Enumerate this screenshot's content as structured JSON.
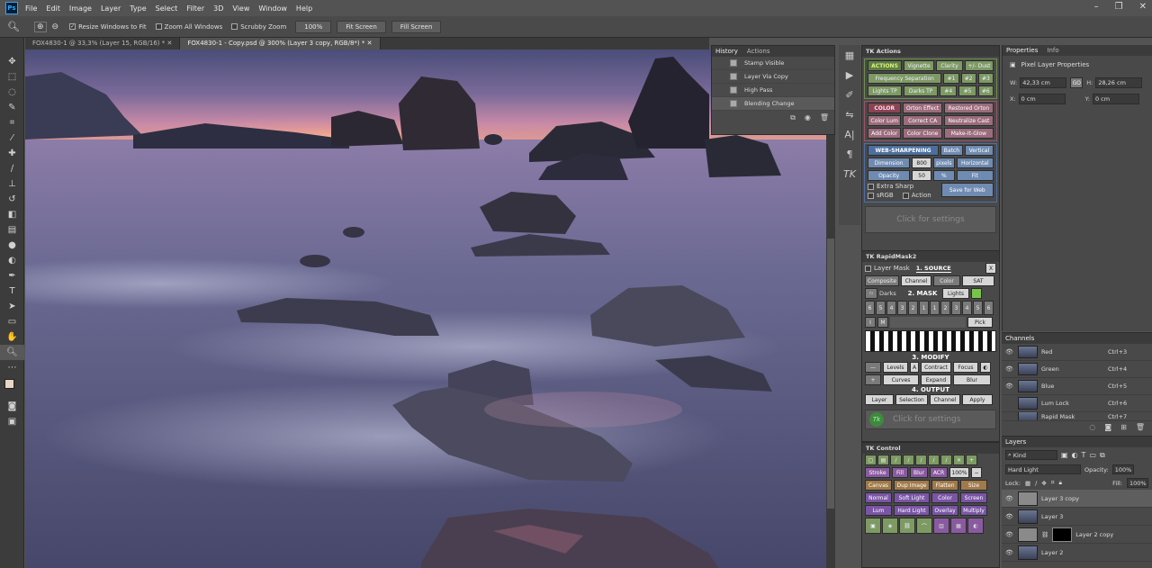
{
  "menubar": {
    "logo": "Ps",
    "items": [
      "File",
      "Edit",
      "Image",
      "Layer",
      "Type",
      "Select",
      "Filter",
      "3D",
      "View",
      "Window",
      "Help"
    ]
  },
  "options": {
    "resize_windows": "Resize Windows to Fit",
    "zoom_all": "Zoom All Windows",
    "scrubby": "Scrubby Zoom",
    "zoom_pct": "100%",
    "fit_screen": "Fit Screen",
    "fill_screen": "Fill Screen"
  },
  "doc_tabs": [
    "FOX4830-1 @ 33,3% (Layer 15, RGB/16) *",
    "FOX4830-1 - Copy.psd @ 300% (Layer 3 copy, RGB/8*) *"
  ],
  "history": {
    "tabs": [
      "History",
      "Actions"
    ],
    "items": [
      "Stamp Visible",
      "Layer Via Copy",
      "High Pass",
      "Blending Change"
    ]
  },
  "tk_actions": {
    "title": "TK Actions",
    "actions_label": "ACTIONS",
    "vignette": "Vignette",
    "clarity": "Clarity",
    "dust": "+/- Dust",
    "freq_sep": "Frequency Separation",
    "n1": "#1",
    "n2": "#2",
    "n3": "#3",
    "lights_tp": "Lights TP",
    "darks_tp": "Darks TP",
    "n4": "#4",
    "n5": "#5",
    "n6": "#6",
    "color_label": "COLOR",
    "orton_effect": "Orton Effect",
    "restored_orton": "Restored Orton",
    "color_lum": "Color Lum",
    "correct_ca": "Correct CA",
    "neutralize_cast": "Neutralize Cast",
    "add_color": "Add Color",
    "color_clone": "Color Clone",
    "make_it_glow": "Make-It-Glow",
    "websharp_label": "WEB-SHARPENING",
    "batch": "Batch",
    "vertical": "Vertical",
    "dimension": "Dimension",
    "dim_val": "800",
    "pixels": "pixels",
    "horizontal": "Horizontal",
    "opacity": "Opacity",
    "op_val": "50",
    "pct": "%",
    "fit": "Fit",
    "extra_sharp": "Extra Sharp",
    "srgb": "sRGB",
    "action": "Action",
    "save_web": "Save for Web",
    "click_settings": "Click for settings"
  },
  "rapidmask": {
    "title": "TK RapidMask2",
    "layer_mask": "Layer Mask",
    "source_label": "1. SOURCE",
    "x": "X",
    "composite": "Composite",
    "channel": "Channel",
    "color": "Color",
    "sat": "SAT",
    "darks": "Darks",
    "mask_label": "2. MASK",
    "lights": "Lights",
    "zone_nums": [
      "6",
      "5",
      "4",
      "3",
      "2",
      "1",
      "1",
      "2",
      "3",
      "4",
      "5",
      "6"
    ],
    "i": "I",
    "m": "M",
    "pick": "Pick",
    "modify_label": "3. MODIFY",
    "minus": "—",
    "levels": "Levels",
    "a": "A",
    "contract": "Contract",
    "focus": "Focus",
    "plus": "+",
    "curves": "Curves",
    "expand": "Expand",
    "blur": "Blur",
    "output_label": "4. OUTPUT",
    "layer": "Layer",
    "selection": "Selection",
    "out_channel": "Channel",
    "apply": "Apply",
    "click_settings": "Click for settings"
  },
  "tkcontrol": {
    "title": "TK Control",
    "stroke": "Stroke",
    "fill": "Fill",
    "blur": "Blur",
    "acr": "ACR",
    "pct": "100%",
    "canvas": "Canvas",
    "dup_image": "Dup Image",
    "flatten": "Flatten",
    "size": "Size",
    "normal": "Normal",
    "soft_light": "Soft Light",
    "color": "Color",
    "screen": "Screen",
    "lum": "Lum",
    "hard_light": "Hard Light",
    "overlay": "Overlay",
    "multiply": "Multiply"
  },
  "properties": {
    "tabs": [
      "Properties",
      "Info"
    ],
    "title": "Pixel Layer Properties",
    "w_label": "W:",
    "w_val": "42,33 cm",
    "go": "GO",
    "h_label": "H:",
    "h_val": "28,26 cm",
    "x_label": "X:",
    "x_val": "0 cm",
    "y_label": "Y:",
    "y_val": "0 cm"
  },
  "channels": {
    "title": "Channels",
    "rows": [
      {
        "name": "Red",
        "key": "Ctrl+3"
      },
      {
        "name": "Green",
        "key": "Ctrl+4"
      },
      {
        "name": "Blue",
        "key": "Ctrl+5"
      },
      {
        "name": "Lum Lock",
        "key": "Ctrl+6"
      },
      {
        "name": "Rapid Mask",
        "key": "Ctrl+7"
      }
    ]
  },
  "layers": {
    "title": "Layers",
    "kind": "Kind",
    "blend": "Hard Light",
    "opacity_label": "Opacity:",
    "opacity_val": "100%",
    "lock_label": "Lock:",
    "fill_label": "Fill:",
    "fill_val": "100%",
    "rows": [
      "Layer 3 copy",
      "Layer 3",
      "Layer 2 copy",
      "Layer 2"
    ]
  }
}
